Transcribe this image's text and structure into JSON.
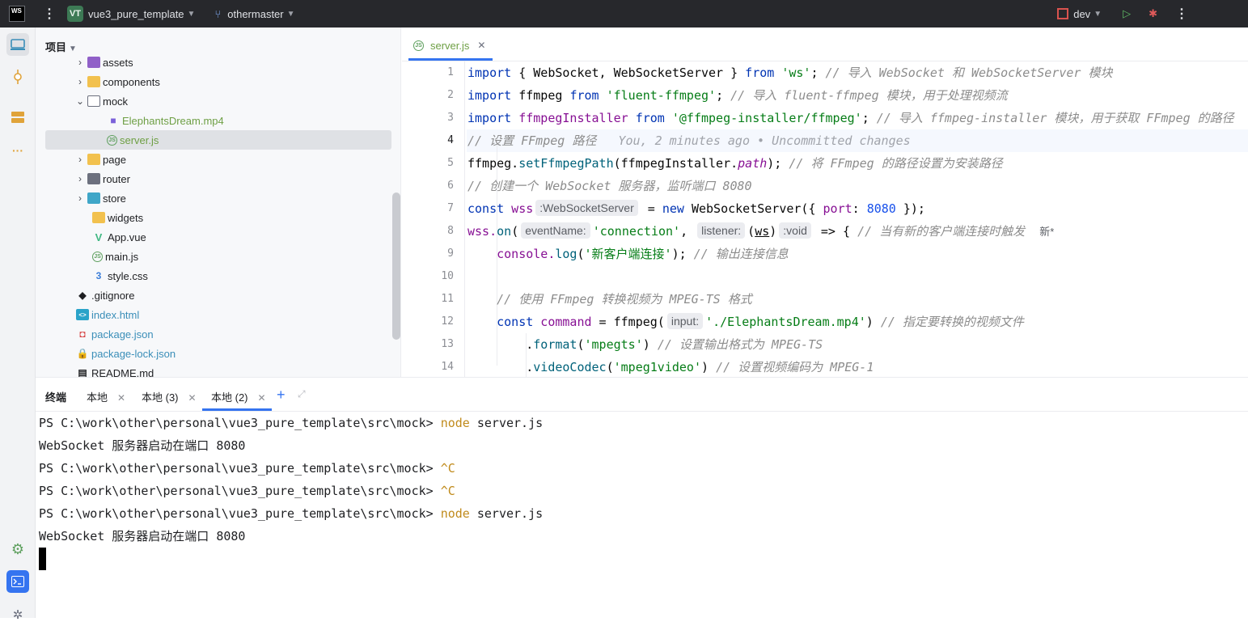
{
  "titlebar": {
    "logo": "WS",
    "project_badge": "VT",
    "project_name": "vue3_pure_template",
    "branch": "othermaster",
    "run_config": "dev"
  },
  "project_panel": {
    "title": "项目",
    "rows": [
      {
        "label": "assets",
        "icon": "folder-purple-icon",
        "expandable": true
      },
      {
        "label": "components",
        "icon": "folder-icon",
        "expandable": true
      },
      {
        "label": "mock",
        "icon": "folder-open-icon",
        "expandable": true,
        "expanded": true
      },
      {
        "label": "ElephantsDream.mp4",
        "icon": "video-file-icon"
      },
      {
        "label": "server.js",
        "icon": "js-file-icon",
        "selected": true
      },
      {
        "label": "page",
        "icon": "folder-icon",
        "expandable": true
      },
      {
        "label": "router",
        "icon": "folder-dark-icon",
        "expandable": true
      },
      {
        "label": "store",
        "icon": "folder-teal-icon",
        "expandable": true
      },
      {
        "label": "widgets",
        "icon": "folder-icon"
      },
      {
        "label": "App.vue",
        "icon": "vue-file-icon"
      },
      {
        "label": "main.js",
        "icon": "js-file-icon"
      },
      {
        "label": "style.css",
        "icon": "css-file-icon"
      },
      {
        "label": ".gitignore",
        "icon": "git-icon"
      },
      {
        "label": "index.html",
        "icon": "html-file-icon"
      },
      {
        "label": "package.json",
        "icon": "npm-icon"
      },
      {
        "label": "package-lock.json",
        "icon": "lock-icon"
      },
      {
        "label": "README.md",
        "icon": "markdown-icon"
      }
    ]
  },
  "editor": {
    "tab_label": "server.js",
    "line_numbers": [
      "1",
      "2",
      "3",
      "4",
      "5",
      "6",
      "7",
      "8",
      "9",
      "10",
      "11",
      "12",
      "13",
      "14"
    ],
    "current_line": "4",
    "code": {
      "l1_a": "import",
      "l1_b": " { WebSocket, WebSocketServer } ",
      "l1_c": "from",
      "l1_d": "'ws'",
      "l1_e": "; ",
      "l1_f": "// 导入 WebSocket 和 WebSocketServer 模块",
      "l2_a": "import",
      "l2_b": " ffmpeg ",
      "l2_c": "from",
      "l2_d": "'fluent-ffmpeg'",
      "l2_e": "; ",
      "l2_f": "// 导入 fluent-ffmpeg 模块，用于处理视频流",
      "l3_a": "import",
      "l3_b": " ffmpegInstaller ",
      "l3_c": "from",
      "l3_d": "'@ffmpeg-installer/ffmpeg'",
      "l3_e": "; ",
      "l3_f": "// 导入 ffmpeg-installer 模块，用于获取 FFmpeg 的路径",
      "l4_a": "// 设置 FFmpeg 路径",
      "l4_blame": "   You, 2 minutes ago • Uncommitted changes",
      "l5_a": "ffmpeg.",
      "l5_b": "setFfmpegPath",
      "l5_c": "(ffmpegInstaller.",
      "l5_d": "path",
      "l5_e": "); ",
      "l5_f": "// 将 FFmpeg 的路径设置为安装路径",
      "l6_a": "// 创建一个 WebSocket 服务器，监听端口 8080",
      "l7_a": "const",
      "l7_b": " wss",
      "l7_hint": ":WebSocketServer",
      "l7_c": " = ",
      "l7_d": "new",
      "l7_e": " WebSocketServer({ ",
      "l7_f": "port",
      "l7_g": ": ",
      "l7_h": "8080",
      "l7_i": " });",
      "l8_a": "wss.",
      "l8_b": "on",
      "l8_c": "(",
      "l8_hint1": "eventName:",
      "l8_d": "'connection'",
      "l8_e": ", ",
      "l8_hint2": "listener:",
      "l8_f": "(",
      "l8_g": "ws",
      "l8_h": ")",
      "l8_hint3": ":void",
      "l8_i": " => { ",
      "l8_j": "// 当有新的客户端连接时触发",
      "l8_new": "新*",
      "l9_a": "    console.",
      "l9_b": "log",
      "l9_c": "(",
      "l9_d": "'新客户端连接'",
      "l9_e": "); ",
      "l9_f": "// 输出连接信息",
      "l11_a": "    // 使用 FFmpeg 转换视频为 MPEG-TS 格式",
      "l12_a": "    const",
      "l12_b": " command",
      "l12_c": " = ffmpeg(",
      "l12_hint": "input:",
      "l12_d": "'./ElephantsDream.mp4'",
      "l12_e": ") ",
      "l12_f": "// 指定要转换的视频文件",
      "l13_a": "        .",
      "l13_b": "format",
      "l13_c": "(",
      "l13_d": "'mpegts'",
      "l13_e": ") ",
      "l13_f": "// 设置输出格式为 MPEG-TS",
      "l14_a": "        .",
      "l14_b": "videoCodec",
      "l14_c": "(",
      "l14_d": "'mpeg1video'",
      "l14_e": ") ",
      "l14_f": "// 设置视频编码为 MPEG-1"
    }
  },
  "terminal": {
    "title": "终端",
    "tabs": [
      "本地",
      "本地 (3)",
      "本地 (2)"
    ],
    "active_tab": "本地 (2)",
    "lines": [
      {
        "prompt": "PS C:\\work\\other\\personal\\vue3_pure_template\\src\\mock> ",
        "cmd": "node",
        "rest": " server.js"
      },
      {
        "prompt": "WebSocket 服务器启动在端口 8080",
        "cmd": "",
        "rest": ""
      },
      {
        "prompt": "PS C:\\work\\other\\personal\\vue3_pure_template\\src\\mock> ",
        "cmd": "^C",
        "rest": ""
      },
      {
        "prompt": "PS C:\\work\\other\\personal\\vue3_pure_template\\src\\mock> ",
        "cmd": "^C",
        "rest": ""
      },
      {
        "prompt": "PS C:\\work\\other\\personal\\vue3_pure_template\\src\\mock> ",
        "cmd": "node",
        "rest": " server.js"
      },
      {
        "prompt": "WebSocket 服务器启动在端口 8080",
        "cmd": "",
        "rest": ""
      }
    ]
  }
}
